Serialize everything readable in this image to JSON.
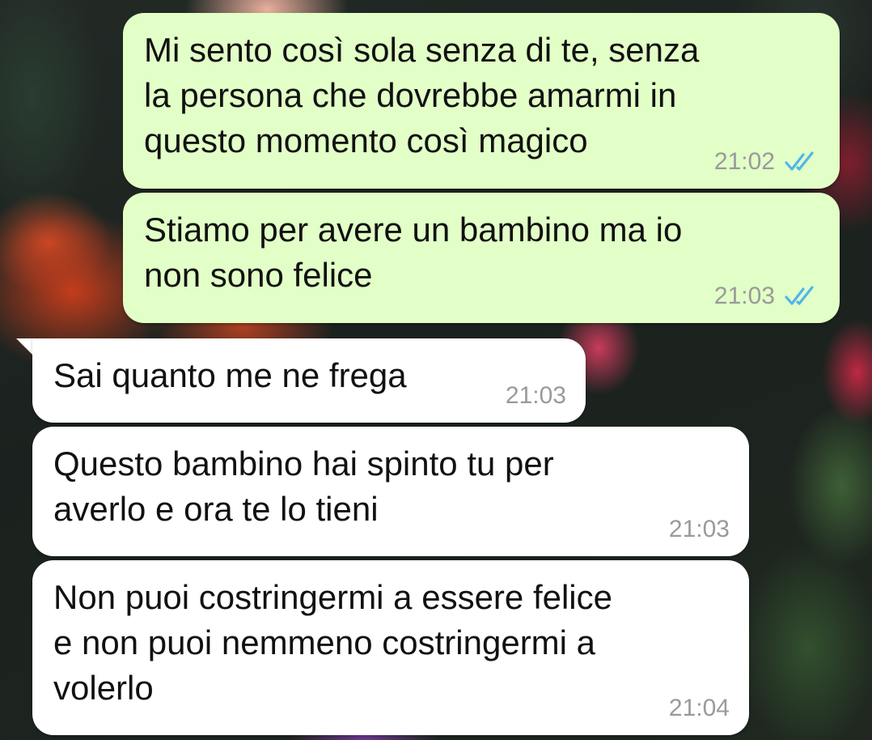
{
  "theme": {
    "outgoing_bubble_color": "#e2ffc7",
    "incoming_bubble_color": "#ffffff",
    "read_tick_color": "#4fb6ec"
  },
  "messages": [
    {
      "direction": "outgoing",
      "text": "Mi sento così sola senza di te, senza\nla persona che dovrebbe amarmi in\nquesto momento così magico",
      "time": "21:02",
      "status_icon": "double-check-read-icon"
    },
    {
      "direction": "outgoing",
      "text": "Stiamo per avere un bambino ma io\nnon sono felice",
      "time": "21:03",
      "status_icon": "double-check-read-icon"
    },
    {
      "direction": "incoming",
      "text": "Sai quanto me ne frega",
      "time": "21:03"
    },
    {
      "direction": "incoming",
      "text": "Questo bambino hai spinto tu per\naverlo e ora te lo tieni",
      "time": "21:03"
    },
    {
      "direction": "incoming",
      "text": "Non puoi costringermi a essere felice\ne non puoi nemmeno costringermi a\nvolerlo",
      "time": "21:04"
    }
  ]
}
